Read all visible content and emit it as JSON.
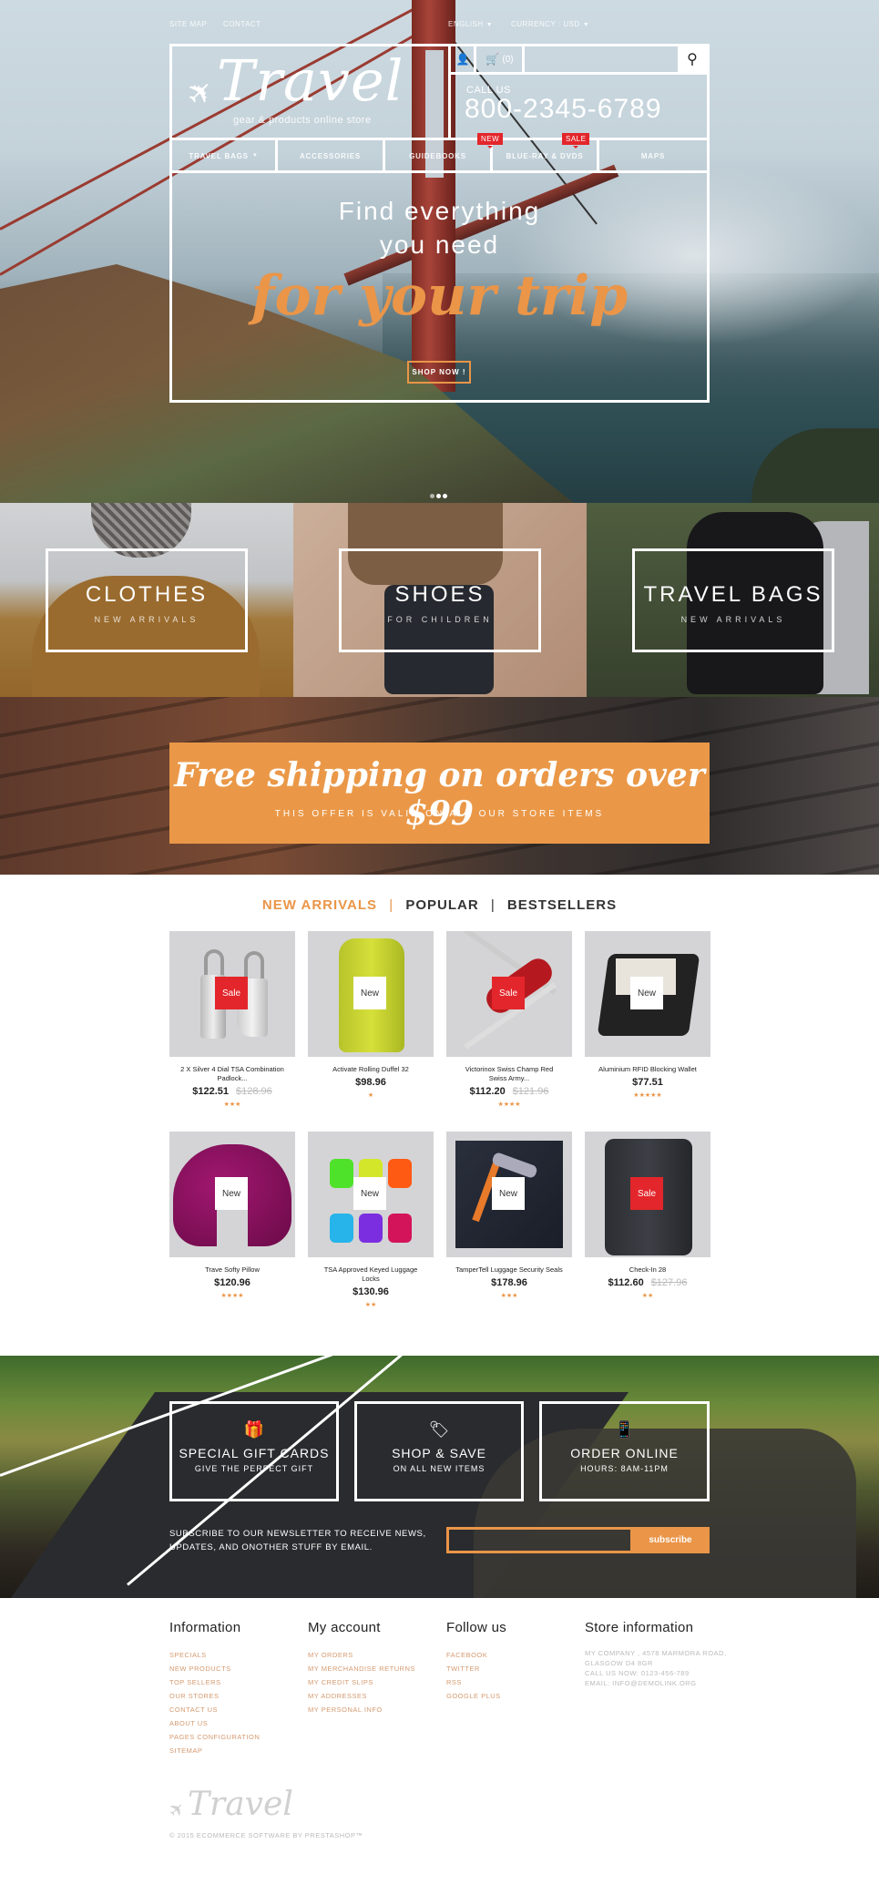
{
  "topbar": {
    "links": [
      "SITE MAP",
      "CONTACT"
    ],
    "language": "ENGLISH",
    "currency": "CURRENCY : USD"
  },
  "header": {
    "logo_text": "Travel",
    "tagline": "gear & products online store",
    "cart_count": "(0)",
    "search_placeholder": "",
    "call_label": "CALL US",
    "phone": "800-2345-6789"
  },
  "nav": [
    {
      "label": "TRAVEL BAGS",
      "has_dropdown": true,
      "badge": ""
    },
    {
      "label": "ACCESSORIES",
      "has_dropdown": false,
      "badge": ""
    },
    {
      "label": "GUIDEBOOKS",
      "has_dropdown": false,
      "badge": "NEW"
    },
    {
      "label": "BLUE-RAY & DVDS",
      "has_dropdown": false,
      "badge": "SALE"
    },
    {
      "label": "MAPS",
      "has_dropdown": false,
      "badge": ""
    }
  ],
  "hero": {
    "line1": "Find everything",
    "line2": "you need",
    "line3": "for your trip",
    "cta": "SHOP NOW !",
    "slides": 3,
    "active_slide": 2
  },
  "categories": [
    {
      "title": "CLOTHES",
      "subtitle": "NEW ARRIVALS"
    },
    {
      "title": "SHOES",
      "subtitle": "FOR CHILDREN"
    },
    {
      "title": "TRAVEL BAGS",
      "subtitle": "NEW ARRIVALS"
    }
  ],
  "shipping": {
    "title": "Free shipping on orders over $99",
    "subtitle": "THIS OFFER IS VALID ON ALL OUR STORE ITEMS"
  },
  "tabs": {
    "items": [
      "NEW ARRIVALS",
      "POPULAR",
      "BESTSELLERS"
    ],
    "active": "NEW ARRIVALS",
    "separator": "|"
  },
  "products": [
    {
      "name": "2 X Silver 4 Dial TSA Combination Padlock...",
      "price": "$122.51",
      "old_price": "$128.96",
      "badge": "Sale",
      "rating": 3
    },
    {
      "name": "Activate Rolling Duffel 32",
      "price": "$98.96",
      "old_price": "",
      "badge": "New",
      "rating": 1
    },
    {
      "name": "Victorinox Swiss Champ Red Swiss Army...",
      "price": "$112.20",
      "old_price": "$121.96",
      "badge": "Sale",
      "rating": 4
    },
    {
      "name": "Aluminium RFID Blocking Wallet",
      "price": "$77.51",
      "old_price": "",
      "badge": "New",
      "rating": 5
    },
    {
      "name": "Trave Softy Pillow",
      "price": "$120.96",
      "old_price": "",
      "badge": "New",
      "rating": 4
    },
    {
      "name": "TSA Approved Keyed Luggage Locks",
      "price": "$130.96",
      "old_price": "",
      "badge": "New",
      "rating": 2
    },
    {
      "name": "TamperTell Luggage Security Seals",
      "price": "$178.96",
      "old_price": "",
      "badge": "New",
      "rating": 3
    },
    {
      "name": "Check-In 28",
      "price": "$112.60",
      "old_price": "$127.96",
      "badge": "Sale",
      "rating": 2
    }
  ],
  "services": [
    {
      "icon": "gift-icon",
      "title": "SPECIAL GIFT CARDS",
      "subtitle": "GIVE THE PERFECT GIFT"
    },
    {
      "icon": "tags-icon",
      "title": "SHOP & SAVE",
      "subtitle": "ON ALL NEW ITEMS"
    },
    {
      "icon": "mobile-phone-icon",
      "title": "ORDER ONLINE",
      "subtitle": "HOURS: 8AM-11PM"
    }
  ],
  "newsletter": {
    "text": "SUBSCRIBE TO OUR NEWSLETTER TO RECEIVE NEWS, UPDATES, AND ONOTHER STUFF BY EMAIL.",
    "input_value": "",
    "button": "subscribe"
  },
  "footer": {
    "columns": [
      {
        "title": "Information",
        "links": [
          "SPECIALS",
          "NEW PRODUCTS",
          "TOP SELLERS",
          "OUR STORES",
          "CONTACT US",
          "ABOUT US",
          "PAGES CONFIGURATION",
          "SITEMAP"
        ]
      },
      {
        "title": "My account",
        "links": [
          "MY ORDERS",
          "MY MERCHANDISE RETURNS",
          "MY CREDIT SLIPS",
          "MY ADDRESSES",
          "MY PERSONAL INFO"
        ]
      },
      {
        "title": "Follow us",
        "links": [
          "FACEBOOK",
          "TWITTER",
          "RSS",
          "GOOGLE PLUS"
        ]
      },
      {
        "title": "Store information",
        "lines": [
          "MY COMPANY , 4578 MARMORA ROAD,",
          "GLASGOW D4 8GR",
          "CALL US NOW: 0123-456-789",
          "EMAIL: INFO@DEMOLINK.ORG"
        ]
      }
    ],
    "logo_text": "Travel",
    "copyright": "© 2015 ECOMMERCE SOFTWARE BY PRESTASHOP™"
  },
  "colors": {
    "accent": "#ea9548",
    "sale": "#e3262b",
    "link": "#d49a70"
  }
}
